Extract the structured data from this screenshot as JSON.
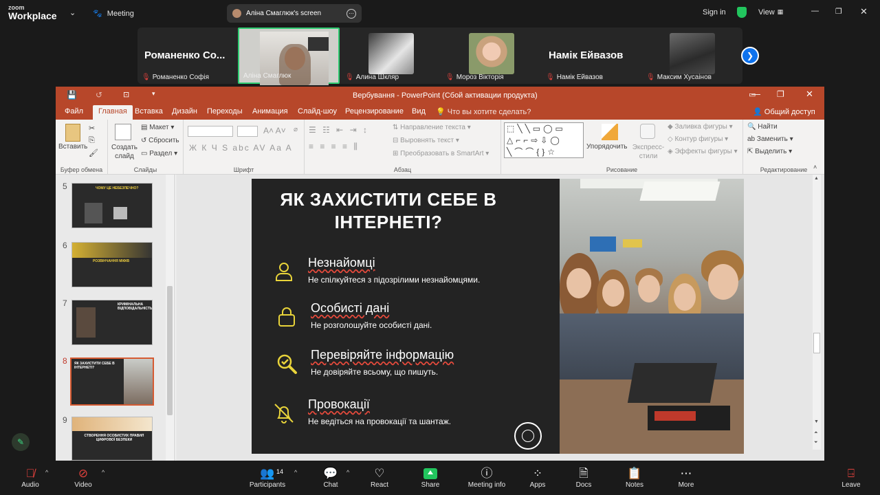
{
  "zoom": {
    "logo_top": "zoom",
    "logo_bottom": "Workplace",
    "meeting_label": "Meeting",
    "share_label": "Аліна Смаглюк's screen",
    "sign_in": "Sign in",
    "view": "View"
  },
  "participants": [
    {
      "big": "Романенко Со...",
      "name": "Романенко Софія",
      "muted": true
    },
    {
      "big": "",
      "name": "Аліна Смаглюк",
      "muted": false,
      "active": true
    },
    {
      "big": "",
      "name": "Алина Шкляр",
      "muted": true
    },
    {
      "big": "",
      "name": "Мороз Вікторія",
      "muted": true
    },
    {
      "big": "Намік Ейвазов",
      "name": "Намік Ейвазов",
      "muted": true
    },
    {
      "big": "",
      "name": "Максим Хусаінов",
      "muted": true
    }
  ],
  "ppt": {
    "title": "Вербування - PowerPoint (Сбой активации продукта)",
    "tabs": [
      "Файл",
      "Главная",
      "Вставка",
      "Дизайн",
      "Переходы",
      "Анимация",
      "Слайд-шоу",
      "Рецензирование",
      "Вид"
    ],
    "tell_me": "Что вы хотите сделать?",
    "share": "Общий доступ",
    "ribbon": {
      "paste": "Вставить",
      "clipboard": "Буфер обмена",
      "new_slide": "Создать слайд",
      "layout": "Макет",
      "reset": "Сбросить",
      "section": "Раздел",
      "slides": "Слайды",
      "font": "Шрифт",
      "font_btns": "Ж К Ч S abc AV Aa A",
      "paragraph": "Абзац",
      "text_dir": "Направление текста",
      "align_text": "Выровнять текст",
      "smartart": "Преобразовать в SmartArt",
      "arrange": "Упорядочить",
      "express": "Экспресс-стили",
      "fill": "Заливка фигуры",
      "outline": "Контур фигуры",
      "effects": "Эффекты фигуры",
      "drawing": "Рисование",
      "find": "Найти",
      "replace": "Заменить",
      "select": "Выделить",
      "editing": "Редактирование"
    },
    "thumbs": [
      {
        "num": "5",
        "title": "ЧОМУ ЦЕ НЕБЕЗПЕЧНО?"
      },
      {
        "num": "6",
        "title": "РОЗВІНЧАННЯ МІФІВ"
      },
      {
        "num": "7",
        "title": "КРИМІНАЛЬНА ВІДПОВІДАЛЬНІСТЬ"
      },
      {
        "num": "8",
        "title": "ЯК ЗАХИСТИТИ СЕБЕ В ІНТЕРНЕТІ?",
        "current": true
      },
      {
        "num": "9",
        "title": "СТВОРЕННЯ ОСОБИСТИХ ПРАВИЛ ЦИФРОВОЇ БЕЗПЕКИ"
      }
    ],
    "slide": {
      "title": "ЯК ЗАХИСТИТИ СЕБЕ В ІНТЕРНЕТІ?",
      "items": [
        {
          "heading": "Незнайомці",
          "text": "Не спілкуйтеся з підозрілими незнайомцями.",
          "icon": "person-icon"
        },
        {
          "heading": "Особисті дані",
          "text": "Не розголошуйте особисті дані.",
          "icon": "lock-icon"
        },
        {
          "heading": "Перевіряйте інформацію",
          "text": "Не довіряйте всьому, що пишуть.",
          "icon": "search-check-icon"
        },
        {
          "heading": "Провокації",
          "text": "Не ведіться на провокації та шантаж.",
          "icon": "bell-off-icon"
        }
      ]
    }
  },
  "toolbar": {
    "audio": "Audio",
    "video": "Video",
    "participants": "Participants",
    "participants_count": "14",
    "chat": "Chat",
    "react": "React",
    "share": "Share",
    "meeting_info": "Meeting info",
    "apps": "Apps",
    "docs": "Docs",
    "notes": "Notes",
    "more": "More",
    "leave": "Leave"
  },
  "colors": {
    "accent_yellow": "#e9d43a",
    "ppt_red": "#b7472a",
    "zoom_blue": "#0e72ed",
    "share_green": "#22c55e"
  }
}
